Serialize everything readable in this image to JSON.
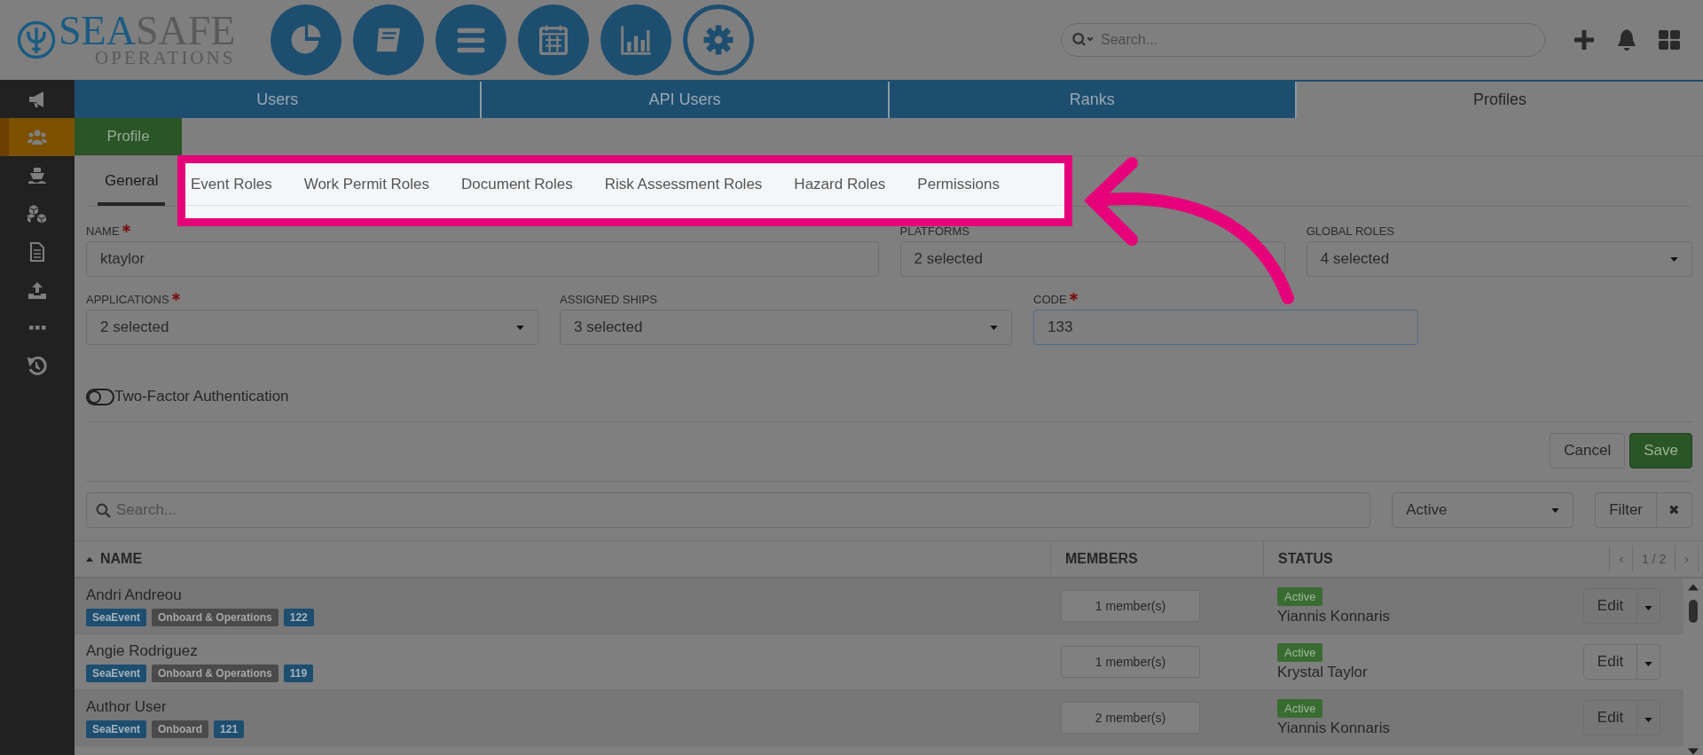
{
  "logo": {
    "word_1": "SEA",
    "word_2": "SAFE",
    "subtitle": "OPERATIONS"
  },
  "app_icons": [
    {
      "kind": "pie",
      "selected": false
    },
    {
      "kind": "book",
      "selected": false
    },
    {
      "kind": "list",
      "selected": false
    },
    {
      "kind": "calendar",
      "selected": false
    },
    {
      "kind": "bars",
      "selected": false
    },
    {
      "kind": "gear",
      "selected": true
    }
  ],
  "search": {
    "placeholder": "Search..."
  },
  "header_actions": [
    {
      "kind": "plus"
    },
    {
      "kind": "bell"
    },
    {
      "kind": "grid"
    }
  ],
  "sidebar": {
    "items": [
      {
        "kind": "megaphone",
        "selected": false
      },
      {
        "kind": "users",
        "selected": true
      },
      {
        "kind": "ship",
        "selected": false
      },
      {
        "kind": "cubes",
        "selected": false
      },
      {
        "kind": "document",
        "selected": false
      },
      {
        "kind": "upload",
        "selected": false
      },
      {
        "kind": "dots",
        "selected": false
      },
      {
        "kind": "history",
        "selected": false
      }
    ]
  },
  "tabs": [
    {
      "label": "Users",
      "selected": false
    },
    {
      "label": "API Users",
      "selected": false
    },
    {
      "label": "Ranks",
      "selected": false
    },
    {
      "label": "Profiles",
      "selected": true
    }
  ],
  "subtabs": [
    {
      "label": "Profile",
      "selected": true
    }
  ],
  "profile_tabs": [
    {
      "label": "General",
      "selected": true,
      "highlighted": false
    },
    {
      "label": "Event Roles",
      "selected": false,
      "highlighted": true
    },
    {
      "label": "Work Permit Roles",
      "selected": false,
      "highlighted": true
    },
    {
      "label": "Document Roles",
      "selected": false,
      "highlighted": true
    },
    {
      "label": "Risk Assessment Roles",
      "selected": false,
      "highlighted": true
    },
    {
      "label": "Hazard Roles",
      "selected": false,
      "highlighted": true
    },
    {
      "label": "Permissions",
      "selected": false,
      "highlighted": true
    }
  ],
  "form": {
    "rows": [
      [
        {
          "label": "NAME",
          "required": true,
          "kind": "text",
          "value": "ktaylor",
          "focused": false
        },
        {
          "label": "PLATFORMS",
          "required": false,
          "kind": "select",
          "value": "2 selected",
          "focused": false
        },
        {
          "label": "GLOBAL ROLES",
          "required": false,
          "kind": "select",
          "value": "4 selected",
          "focused": false
        }
      ],
      [
        {
          "label": "APPLICATIONS",
          "required": true,
          "kind": "select",
          "value": "2 selected",
          "focused": false
        },
        {
          "label": "ASSIGNED SHIPS",
          "required": false,
          "kind": "select",
          "value": "3 selected",
          "focused": false
        },
        {
          "label": "CODE",
          "required": true,
          "kind": "text",
          "value": "133",
          "focused": true
        }
      ]
    ]
  },
  "two_factor": {
    "label": "Two-Factor Authentication",
    "on": false
  },
  "buttons": [
    {
      "label": "Cancel",
      "kind": "secondary"
    },
    {
      "label": "Save",
      "kind": "primary"
    }
  ],
  "list_search": {
    "placeholder": "Search..."
  },
  "status_filter": {
    "value": "Active"
  },
  "filter_button": {
    "label": "Filter"
  },
  "clear_button": {
    "label": "✖"
  },
  "table": {
    "columns": [
      {
        "label": "NAME",
        "sorted": true
      },
      {
        "label": "MEMBERS",
        "sorted": false
      },
      {
        "label": "STATUS",
        "sorted": false
      }
    ],
    "pagination": {
      "prev": "‹",
      "page": "1 / 2",
      "next": "›"
    },
    "rows": [
      {
        "name": "Andri Andreou",
        "tags": [
          {
            "label": "SeaEvent",
            "kind": "app"
          },
          {
            "label": "Onboard & Operations",
            "kind": "group"
          },
          {
            "label": "122",
            "kind": "code"
          }
        ],
        "members": "1 member(s)",
        "status": "Active",
        "owner": "Yiannis Konnaris",
        "action": "Edit"
      },
      {
        "name": "Angie Rodriguez",
        "tags": [
          {
            "label": "SeaEvent",
            "kind": "app"
          },
          {
            "label": "Onboard & Operations",
            "kind": "group"
          },
          {
            "label": "119",
            "kind": "code"
          }
        ],
        "members": "1 member(s)",
        "status": "Active",
        "owner": "Krystal Taylor",
        "action": "Edit"
      },
      {
        "name": "Author User",
        "tags": [
          {
            "label": "SeaEvent",
            "kind": "app"
          },
          {
            "label": "Onboard",
            "kind": "group"
          },
          {
            "label": "121",
            "kind": "code"
          }
        ],
        "members": "2 member(s)",
        "status": "Active",
        "owner": "Yiannis Konnaris",
        "action": "Edit"
      }
    ]
  }
}
